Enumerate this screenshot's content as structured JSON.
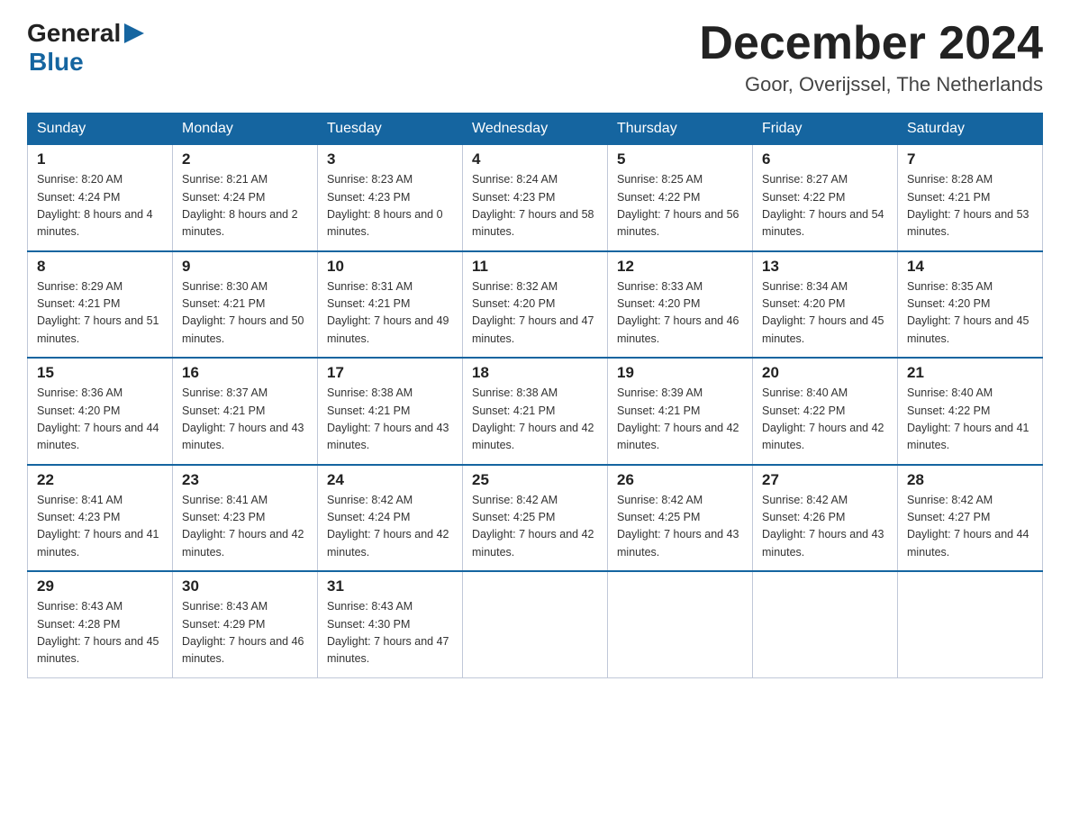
{
  "header": {
    "logo_general": "General",
    "logo_blue": "Blue",
    "month_title": "December 2024",
    "location": "Goor, Overijssel, The Netherlands"
  },
  "weekdays": [
    "Sunday",
    "Monday",
    "Tuesday",
    "Wednesday",
    "Thursday",
    "Friday",
    "Saturday"
  ],
  "weeks": [
    [
      {
        "day": "1",
        "sunrise": "8:20 AM",
        "sunset": "4:24 PM",
        "daylight": "8 hours and 4 minutes."
      },
      {
        "day": "2",
        "sunrise": "8:21 AM",
        "sunset": "4:24 PM",
        "daylight": "8 hours and 2 minutes."
      },
      {
        "day": "3",
        "sunrise": "8:23 AM",
        "sunset": "4:23 PM",
        "daylight": "8 hours and 0 minutes."
      },
      {
        "day": "4",
        "sunrise": "8:24 AM",
        "sunset": "4:23 PM",
        "daylight": "7 hours and 58 minutes."
      },
      {
        "day": "5",
        "sunrise": "8:25 AM",
        "sunset": "4:22 PM",
        "daylight": "7 hours and 56 minutes."
      },
      {
        "day": "6",
        "sunrise": "8:27 AM",
        "sunset": "4:22 PM",
        "daylight": "7 hours and 54 minutes."
      },
      {
        "day": "7",
        "sunrise": "8:28 AM",
        "sunset": "4:21 PM",
        "daylight": "7 hours and 53 minutes."
      }
    ],
    [
      {
        "day": "8",
        "sunrise": "8:29 AM",
        "sunset": "4:21 PM",
        "daylight": "7 hours and 51 minutes."
      },
      {
        "day": "9",
        "sunrise": "8:30 AM",
        "sunset": "4:21 PM",
        "daylight": "7 hours and 50 minutes."
      },
      {
        "day": "10",
        "sunrise": "8:31 AM",
        "sunset": "4:21 PM",
        "daylight": "7 hours and 49 minutes."
      },
      {
        "day": "11",
        "sunrise": "8:32 AM",
        "sunset": "4:20 PM",
        "daylight": "7 hours and 47 minutes."
      },
      {
        "day": "12",
        "sunrise": "8:33 AM",
        "sunset": "4:20 PM",
        "daylight": "7 hours and 46 minutes."
      },
      {
        "day": "13",
        "sunrise": "8:34 AM",
        "sunset": "4:20 PM",
        "daylight": "7 hours and 45 minutes."
      },
      {
        "day": "14",
        "sunrise": "8:35 AM",
        "sunset": "4:20 PM",
        "daylight": "7 hours and 45 minutes."
      }
    ],
    [
      {
        "day": "15",
        "sunrise": "8:36 AM",
        "sunset": "4:20 PM",
        "daylight": "7 hours and 44 minutes."
      },
      {
        "day": "16",
        "sunrise": "8:37 AM",
        "sunset": "4:21 PM",
        "daylight": "7 hours and 43 minutes."
      },
      {
        "day": "17",
        "sunrise": "8:38 AM",
        "sunset": "4:21 PM",
        "daylight": "7 hours and 43 minutes."
      },
      {
        "day": "18",
        "sunrise": "8:38 AM",
        "sunset": "4:21 PM",
        "daylight": "7 hours and 42 minutes."
      },
      {
        "day": "19",
        "sunrise": "8:39 AM",
        "sunset": "4:21 PM",
        "daylight": "7 hours and 42 minutes."
      },
      {
        "day": "20",
        "sunrise": "8:40 AM",
        "sunset": "4:22 PM",
        "daylight": "7 hours and 42 minutes."
      },
      {
        "day": "21",
        "sunrise": "8:40 AM",
        "sunset": "4:22 PM",
        "daylight": "7 hours and 41 minutes."
      }
    ],
    [
      {
        "day": "22",
        "sunrise": "8:41 AM",
        "sunset": "4:23 PM",
        "daylight": "7 hours and 41 minutes."
      },
      {
        "day": "23",
        "sunrise": "8:41 AM",
        "sunset": "4:23 PM",
        "daylight": "7 hours and 42 minutes."
      },
      {
        "day": "24",
        "sunrise": "8:42 AM",
        "sunset": "4:24 PM",
        "daylight": "7 hours and 42 minutes."
      },
      {
        "day": "25",
        "sunrise": "8:42 AM",
        "sunset": "4:25 PM",
        "daylight": "7 hours and 42 minutes."
      },
      {
        "day": "26",
        "sunrise": "8:42 AM",
        "sunset": "4:25 PM",
        "daylight": "7 hours and 43 minutes."
      },
      {
        "day": "27",
        "sunrise": "8:42 AM",
        "sunset": "4:26 PM",
        "daylight": "7 hours and 43 minutes."
      },
      {
        "day": "28",
        "sunrise": "8:42 AM",
        "sunset": "4:27 PM",
        "daylight": "7 hours and 44 minutes."
      }
    ],
    [
      {
        "day": "29",
        "sunrise": "8:43 AM",
        "sunset": "4:28 PM",
        "daylight": "7 hours and 45 minutes."
      },
      {
        "day": "30",
        "sunrise": "8:43 AM",
        "sunset": "4:29 PM",
        "daylight": "7 hours and 46 minutes."
      },
      {
        "day": "31",
        "sunrise": "8:43 AM",
        "sunset": "4:30 PM",
        "daylight": "7 hours and 47 minutes."
      },
      null,
      null,
      null,
      null
    ]
  ]
}
